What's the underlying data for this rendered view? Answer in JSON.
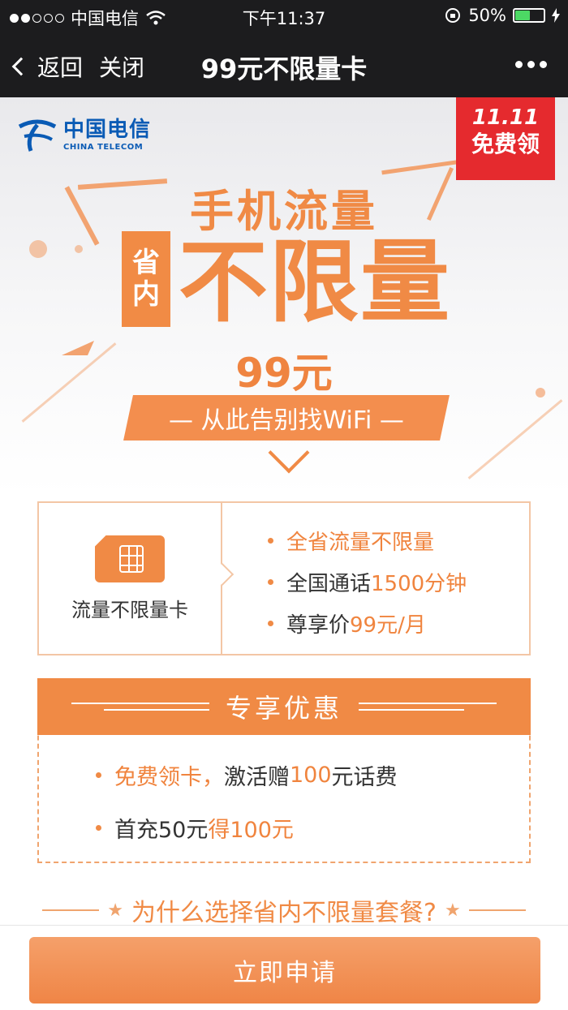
{
  "status_bar": {
    "carrier": "中国电信",
    "time": "下午11:37",
    "battery": "50%",
    "battery_level": 0.5
  },
  "nav": {
    "back_label": "返回",
    "close_label": "关闭",
    "title": "99元不限量卡"
  },
  "hero": {
    "logo_cn": "中国电信",
    "logo_en": "CHINA TELECOM",
    "ribbon_top": "11.11",
    "ribbon_bottom": "免费领",
    "headline": "手机流量",
    "tag_line1": "省",
    "tag_line2": "内",
    "big_text": "不限量",
    "price": "99元",
    "slogan": "— 从此告别找WiFi —"
  },
  "card": {
    "label": "流量不限量卡",
    "bullets": [
      {
        "plain": "",
        "accent": "全省流量不限量"
      },
      {
        "plain": "全国通话",
        "accent": "1500分钟"
      },
      {
        "plain": "尊享价",
        "accent": "99元/月"
      }
    ]
  },
  "promo": {
    "title": "专享优惠",
    "items": [
      {
        "accent": "免费领卡，",
        "plain": "激活赠",
        "accent2": "100",
        "plain2": "元话费"
      },
      {
        "plain": "首充50元",
        "accent": "得100元"
      }
    ]
  },
  "why": {
    "text": "为什么选择省内不限量套餐?"
  },
  "action": {
    "apply_label": "立即申请"
  },
  "colors": {
    "accent": "#f08a45",
    "ribbon": "#e52a2e",
    "logo_blue": "#0a5bb5"
  }
}
